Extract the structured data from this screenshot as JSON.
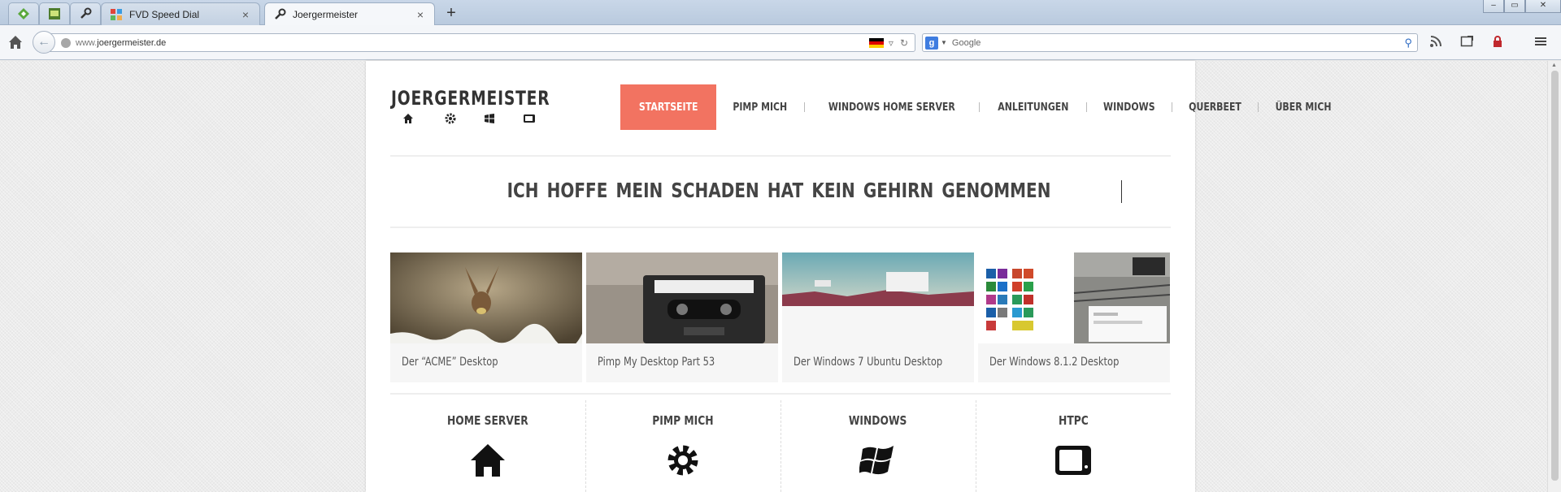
{
  "browser": {
    "tabs": [
      {
        "title": "FVD Speed Dial",
        "close": "×"
      },
      {
        "title": "Joergermeister",
        "close": "×"
      }
    ],
    "new_tab": "+",
    "window_buttons": [
      "–",
      "▭",
      "✕"
    ],
    "url_host": "www.",
    "url_domain": "joergermeister.de",
    "search_engine": "g",
    "search_placeholder": "Google",
    "icons": [
      "home-icon",
      "back-icon",
      "globe-icon",
      "flag-de-icon",
      "refresh-icon",
      "search-icon",
      "rss-icon",
      "fullscreen-icon",
      "lock-icon",
      "menu-icon"
    ]
  },
  "site": {
    "logo": "JOERGERMEISTER",
    "logo_icons": [
      "home-icon",
      "gear-icon",
      "windows-icon",
      "tv-icon"
    ],
    "nav": [
      {
        "label": "STARTSEITE",
        "active": true
      },
      {
        "label": "PIMP MICH"
      },
      {
        "label": "WINDOWS HOME SERVER"
      },
      {
        "label": "ANLEITUNGEN"
      },
      {
        "label": "WINDOWS"
      },
      {
        "label": "QUERBEET"
      },
      {
        "label": "ÜBER MICH"
      }
    ],
    "headline": "ICH HOFFE MEIN SCHADEN HAT KEIN GEHIRN GENOMMEN",
    "posts": [
      {
        "caption": "Der “ACME” Desktop"
      },
      {
        "caption": "Pimp My Desktop Part 53"
      },
      {
        "caption": "Der Windows 7 Ubuntu Desktop"
      },
      {
        "caption": "Der Windows 8.1.2 Desktop"
      }
    ],
    "categories": [
      {
        "title": "HOME SERVER",
        "icon": "home-icon"
      },
      {
        "title": "PIMP MICH",
        "icon": "gear-icon"
      },
      {
        "title": "WINDOWS",
        "icon": "windows-icon"
      },
      {
        "title": "HTPC",
        "icon": "tv-icon"
      }
    ],
    "colors": {
      "accent": "#f27361",
      "text": "#444444"
    }
  }
}
